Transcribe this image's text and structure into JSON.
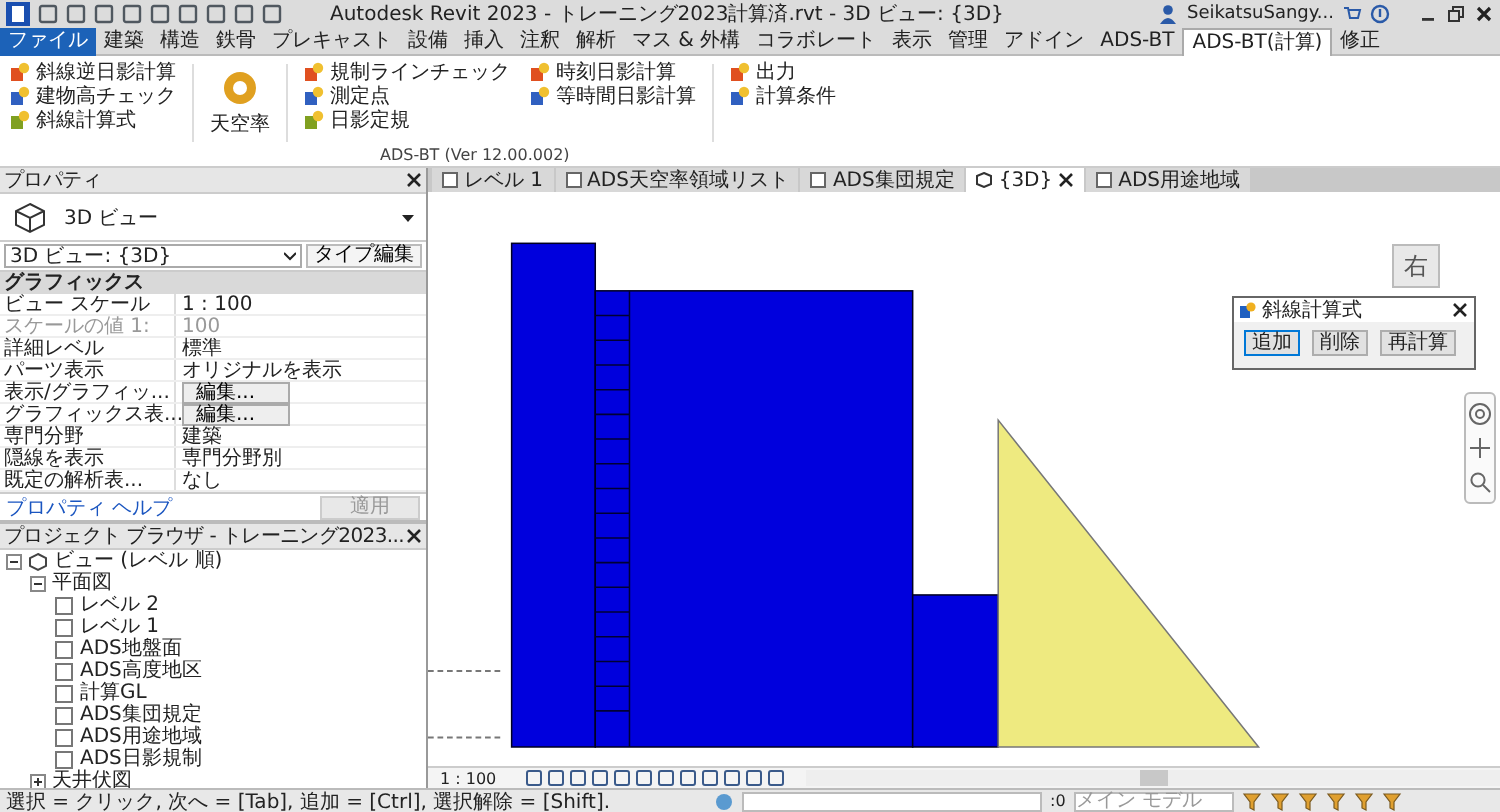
{
  "title_bar": {
    "title": "Autodesk Revit 2023 - トレーニング2023計算済.rvt - 3D ビュー: {3D}",
    "user": "SeikatsuSangy..."
  },
  "ribbon": {
    "tabs": [
      {
        "label": "ファイル",
        "selected": false,
        "kind": "file"
      },
      {
        "label": "建築",
        "selected": false,
        "kind": "tab"
      },
      {
        "label": "構造",
        "selected": false,
        "kind": "tab"
      },
      {
        "label": "鉄骨",
        "selected": false,
        "kind": "tab"
      },
      {
        "label": "プレキャスト",
        "selected": false,
        "kind": "tab"
      },
      {
        "label": "設備",
        "selected": false,
        "kind": "tab"
      },
      {
        "label": "挿入",
        "selected": false,
        "kind": "tab"
      },
      {
        "label": "注釈",
        "selected": false,
        "kind": "tab"
      },
      {
        "label": "解析",
        "selected": false,
        "kind": "tab"
      },
      {
        "label": "マス & 外構",
        "selected": false,
        "kind": "tab"
      },
      {
        "label": "コラボレート",
        "selected": false,
        "kind": "tab"
      },
      {
        "label": "表示",
        "selected": false,
        "kind": "tab"
      },
      {
        "label": "管理",
        "selected": false,
        "kind": "tab"
      },
      {
        "label": "アドイン",
        "selected": false,
        "kind": "tab"
      },
      {
        "label": "ADS-BT",
        "selected": false,
        "kind": "tab"
      },
      {
        "label": "ADS-BT(計算)",
        "selected": true,
        "kind": "tab"
      },
      {
        "label": "修正",
        "selected": false,
        "kind": "tab"
      }
    ],
    "columns": [
      {
        "buttons": [
          "斜線逆日影計算",
          "建物高チェック",
          "斜線計算式"
        ]
      },
      {
        "buttons": [
          "天空率"
        ]
      },
      {
        "buttons": [
          "規制ラインチェック",
          "測定点",
          "日影定規"
        ]
      },
      {
        "buttons": [
          "時刻日影計算",
          "等時間日影計算"
        ]
      },
      {
        "buttons": [
          "出力",
          "計算条件"
        ]
      }
    ],
    "panel_label": "ADS-BT (Ver 12.00.002)"
  },
  "properties": {
    "title": "プロパティ",
    "type_name": "3D ビュー",
    "view_selector": "3D ビュー: {3D}",
    "edit_type_button": "タイプ編集",
    "rows": [
      {
        "kind": "group",
        "label": "グラフィックス"
      },
      {
        "kind": "value",
        "label": "ビュー スケール",
        "value": "1 : 100"
      },
      {
        "kind": "readonly",
        "label": "スケールの値 1:",
        "value": "100"
      },
      {
        "kind": "value",
        "label": "詳細レベル",
        "value": "標準"
      },
      {
        "kind": "value",
        "label": "パーツ表示",
        "value": "オリジナルを表示"
      },
      {
        "kind": "button",
        "label": "表示/グラフィッ...",
        "value": "編集..."
      },
      {
        "kind": "button",
        "label": "グラフィックス表...",
        "value": "編集..."
      },
      {
        "kind": "value",
        "label": "専門分野",
        "value": "建築"
      },
      {
        "kind": "value",
        "label": "隠線を表示",
        "value": "専門分野別"
      },
      {
        "kind": "value",
        "label": "既定の解析表...",
        "value": "なし"
      }
    ],
    "help_link": "プロパティ ヘルプ",
    "apply_button": {
      "label": "適用",
      "disabled": true
    }
  },
  "project_browser": {
    "title": "プロジェクト ブラウザ - トレーニング2023...",
    "tree": [
      {
        "label": "ビュー (レベル 順)",
        "kind": "root",
        "expanded": true,
        "children": [
          {
            "label": "平面図",
            "expanded": true,
            "children": [
              {
                "label": "レベル 2",
                "kind": "view"
              },
              {
                "label": "レベル 1",
                "kind": "view"
              },
              {
                "label": "ADS地盤面",
                "kind": "view"
              },
              {
                "label": "ADS高度地区",
                "kind": "view"
              },
              {
                "label": "計算GL",
                "kind": "view"
              },
              {
                "label": "ADS集団規定",
                "kind": "view"
              },
              {
                "label": "ADS用途地域",
                "kind": "view"
              },
              {
                "label": "ADS日影規制",
                "kind": "view"
              }
            ]
          },
          {
            "label": "天井伏図",
            "expanded": false
          }
        ]
      }
    ]
  },
  "view_tabs": [
    {
      "label": "レベル 1",
      "selected": false,
      "kind": "plan"
    },
    {
      "label": "ADS天空率領域リスト",
      "selected": false,
      "kind": "schedule"
    },
    {
      "label": "ADS集団規定",
      "selected": false,
      "kind": "plan"
    },
    {
      "label": "{3D}",
      "selected": true,
      "kind": "model"
    },
    {
      "label": "ADS用途地域",
      "selected": false,
      "kind": "plan"
    }
  ],
  "dialog": {
    "title": "斜線計算式",
    "buttons": [
      {
        "label": "追加",
        "selected": true
      },
      {
        "label": "削除",
        "selected": false
      },
      {
        "label": "再計算",
        "selected": false
      }
    ]
  },
  "view_cube": {
    "label": "右"
  },
  "view_control_bar": {
    "scale": "1 : 100"
  },
  "status_bar": {
    "text": "選択 = クリック, 次へ = [Tab], 追加 = [Ctrl], 選択解除 = [Shift].",
    "selection_count": ":0",
    "model_placeholder": "メイン モデル"
  }
}
